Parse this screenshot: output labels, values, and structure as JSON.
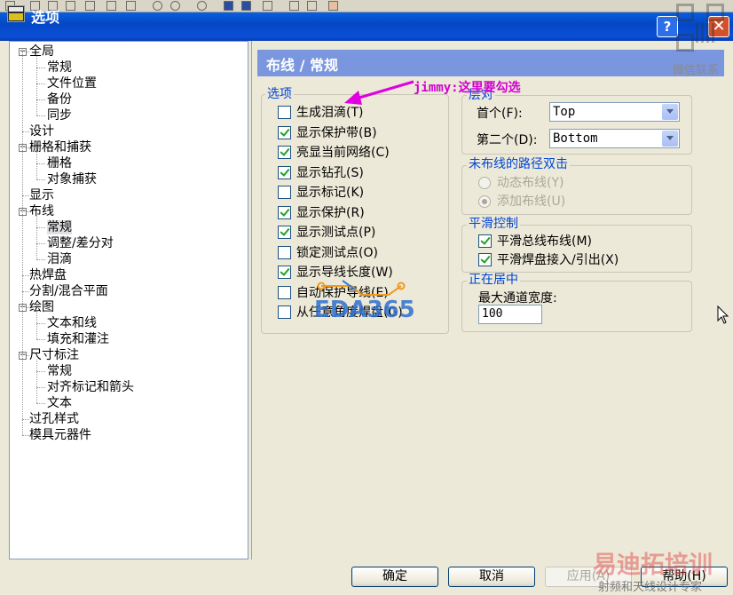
{
  "window": {
    "title": "选项",
    "help_label": "?",
    "close_label": "✕"
  },
  "tree": {
    "items": [
      {
        "label": "全局",
        "level": 0,
        "expander": "−"
      },
      {
        "label": "常规",
        "level": 1
      },
      {
        "label": "文件位置",
        "level": 1
      },
      {
        "label": "备份",
        "level": 1
      },
      {
        "label": "同步",
        "level": 1
      },
      {
        "label": "设计",
        "level": 0
      },
      {
        "label": "栅格和捕获",
        "level": 0,
        "expander": "−"
      },
      {
        "label": "栅格",
        "level": 1
      },
      {
        "label": "对象捕获",
        "level": 1
      },
      {
        "label": "显示",
        "level": 0
      },
      {
        "label": "布线",
        "level": 0,
        "expander": "−"
      },
      {
        "label": "常规",
        "level": 1,
        "selected": true
      },
      {
        "label": "调整/差分对",
        "level": 1
      },
      {
        "label": "泪滴",
        "level": 1
      },
      {
        "label": "热焊盘",
        "level": 0
      },
      {
        "label": "分割/混合平面",
        "level": 0
      },
      {
        "label": "绘图",
        "level": 0,
        "expander": "−"
      },
      {
        "label": "文本和线",
        "level": 1
      },
      {
        "label": "填充和灌注",
        "level": 1
      },
      {
        "label": "尺寸标注",
        "level": 0,
        "expander": "−"
      },
      {
        "label": "常规",
        "level": 1
      },
      {
        "label": "对齐标记和箭头",
        "level": 1
      },
      {
        "label": "文本",
        "level": 1
      },
      {
        "label": "过孔样式",
        "level": 0
      },
      {
        "label": "模具元器件",
        "level": 0
      }
    ]
  },
  "page": {
    "header": "布线 / 常规"
  },
  "options_group": {
    "title": "选项",
    "items": [
      {
        "label": "生成泪滴(T)",
        "checked": false
      },
      {
        "label": "显示保护带(B)",
        "checked": true
      },
      {
        "label": "亮显当前网络(C)",
        "checked": true
      },
      {
        "label": "显示钻孔(S)",
        "checked": true
      },
      {
        "label": "显示标记(K)",
        "checked": false
      },
      {
        "label": "显示保护(R)",
        "checked": true
      },
      {
        "label": "显示测试点(P)",
        "checked": true
      },
      {
        "label": "锁定测试点(O)",
        "checked": false
      },
      {
        "label": "显示导线长度(W)",
        "checked": true
      },
      {
        "label": "自动保护导线(E)",
        "checked": false
      },
      {
        "label": "从任意角度焊盘(G)",
        "checked": false
      }
    ]
  },
  "layer_pair_group": {
    "title": "层对",
    "first_label": "首个(F):",
    "first_value": "Top",
    "second_label": "第二个(D):",
    "second_value": "Bottom"
  },
  "unrouted_group": {
    "title": "未布线的路径双击",
    "options": [
      {
        "label": "动态布线(Y)",
        "selected": false
      },
      {
        "label": "添加布线(U)",
        "selected": true
      }
    ]
  },
  "smoothing_group": {
    "title": "平滑控制",
    "items": [
      {
        "label": "平滑总线布线(M)",
        "checked": true
      },
      {
        "label": "平滑焊盘接入/引出(X)",
        "checked": true
      }
    ]
  },
  "centering_group": {
    "title": "正在居中",
    "label": "最大通道宽度:",
    "value": "100"
  },
  "annotation": {
    "text": "jimmy:这里要勾选",
    "color": "#d100d1"
  },
  "buttons": {
    "ok": "确定",
    "cancel": "取消",
    "apply": "应用(A)",
    "help": "帮助(H)"
  },
  "watermarks": {
    "eda": "EDA365",
    "wechat": "微信联系",
    "brand": "易迪拓培训",
    "brand_sub": "射频和天线设计专家"
  },
  "colors": {
    "titlebar": "#0a4fd6",
    "page_header": "#7a96df",
    "group_title": "#0046d5",
    "check_mark": "#21a121"
  }
}
